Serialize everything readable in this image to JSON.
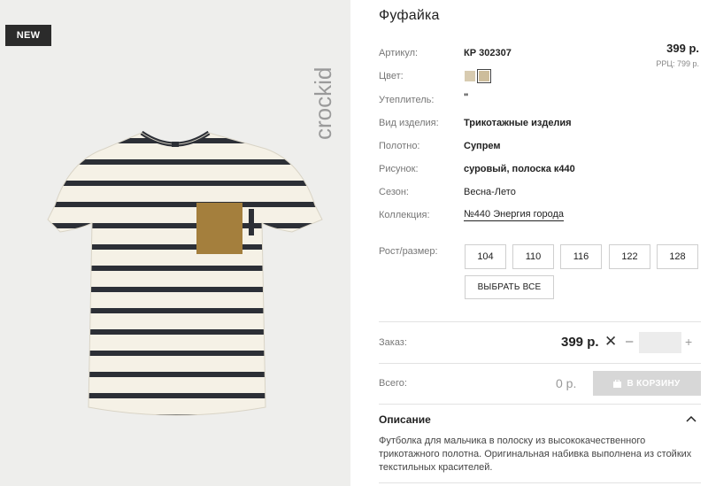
{
  "image": {
    "badge": "NEW",
    "brand": "crockid"
  },
  "product": {
    "title": "Фуфайка",
    "price": "399 р.",
    "rrp": "РРЦ: 799 р."
  },
  "attributes": [
    {
      "label": "Артикул:",
      "value": "КР 302307"
    },
    {
      "label": "Цвет:",
      "value": ""
    },
    {
      "label": "Утеплитель:",
      "value": "\""
    },
    {
      "label": "Вид изделия:",
      "value": "Трикотажные изделия"
    },
    {
      "label": "Полотно:",
      "value": "Супрем"
    },
    {
      "label": "Рисунок:",
      "value": "суровый, полоска к440"
    },
    {
      "label": "Сезон:",
      "value": "Весна-Лето"
    },
    {
      "label": "Коллекция:",
      "value": "№440 Энергия города"
    }
  ],
  "colors": {
    "swatch1": "#d8cbb0",
    "swatch2": "#cdbd9c"
  },
  "sizes": {
    "label": "Рост/размер:",
    "options": [
      "104",
      "110",
      "116",
      "122",
      "128"
    ],
    "select_all": "ВЫБРАТЬ ВСЕ"
  },
  "order": {
    "label": "Заказ:",
    "price": "399 р.",
    "remove_icon": "close-icon",
    "minus": "–",
    "plus": "+",
    "quantity": ""
  },
  "total": {
    "label": "Всего:",
    "value": "0 р.",
    "cart_button": "В КОРЗИНУ"
  },
  "description": {
    "title": "Описание",
    "text": "Футболка для мальчика в полоску из высококачественного трикотажного полотна. Оригинальная набивка выполнена из стойких текстильных красителей."
  }
}
